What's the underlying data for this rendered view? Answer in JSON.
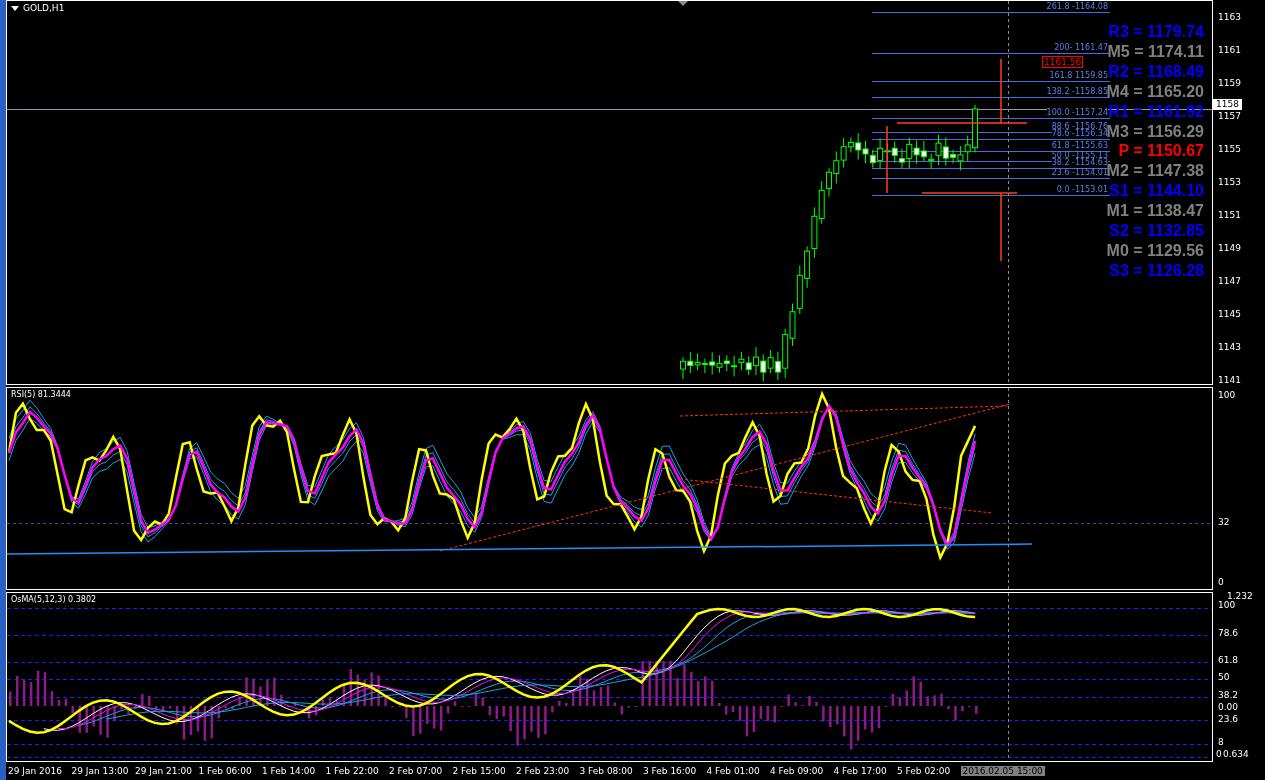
{
  "window": {
    "title": "GOLD,H1"
  },
  "price_pane": {
    "axis_labels": [
      "1163",
      "1161",
      "1159",
      "1157",
      "1155",
      "1153",
      "1151",
      "1149",
      "1147",
      "1145",
      "1143",
      "1141"
    ],
    "current_price": "1158",
    "price_tag": "1161.56",
    "fibonacci_levels": [
      {
        "label": "261.8 -1164.08"
      },
      {
        "label": "200- 1161.47"
      },
      {
        "label": "161.8 1159.85"
      },
      {
        "label": "138.2 -1158.85"
      },
      {
        "label": "100.0 -1157.24"
      },
      {
        "label": "88.6 -1156.76"
      },
      {
        "label": "78.6 -1156.34"
      },
      {
        "label": "61.8 -1155.63"
      },
      {
        "label": "50.0 -1155.13"
      },
      {
        "label": "38.2 -1154.63"
      },
      {
        "label": "23.6 -1154.01"
      },
      {
        "label": "0.0 -1153.01"
      }
    ],
    "pivot_levels": [
      {
        "label": "R3 = 1179.74",
        "color": "#0000ff"
      },
      {
        "label": "M5 = 1174.11",
        "color": "#808080"
      },
      {
        "label": "R2 = 1168.49",
        "color": "#0000ff"
      },
      {
        "label": "M4 = 1165.20",
        "color": "#808080"
      },
      {
        "label": "R1 = 1161.92",
        "color": "#0000ff"
      },
      {
        "label": "M3 = 1156.29",
        "color": "#808080"
      },
      {
        "label": "P  = 1150.67",
        "color": "#ff0000"
      },
      {
        "label": "M2 = 1147.38",
        "color": "#808080"
      },
      {
        "label": "S1 = 1144.10",
        "color": "#0000ff"
      },
      {
        "label": "M1 = 1138.47",
        "color": "#808080"
      },
      {
        "label": "S2 = 1132.85",
        "color": "#0000ff"
      },
      {
        "label": "M0 = 1129.56",
        "color": "#808080"
      },
      {
        "label": "S3 = 1126.28",
        "color": "#0000ff"
      }
    ]
  },
  "rsi_pane": {
    "label": "RSI(5) 81.3444",
    "axis_labels": [
      "100",
      "32",
      "0"
    ]
  },
  "osma_pane": {
    "label": "OsMA(5,12,3) 0.3802",
    "axis_labels": [
      "1.232",
      "100",
      "78.6",
      "61.8",
      "50",
      "38.2",
      "0.00",
      "23.6",
      "8",
      "0",
      "0.634"
    ]
  },
  "time_axis": {
    "labels": [
      "29 Jan 2016",
      "29 Jan 13:00",
      "29 Jan 21:00",
      "1 Feb 06:00",
      "1 Feb 14:00",
      "1 Feb 22:00",
      "2 Feb 07:00",
      "2 Feb 15:00",
      "2 Feb 23:00",
      "3 Feb 08:00",
      "3 Feb 16:00",
      "4 Feb 01:00",
      "4 Feb 09:00",
      "4 Feb 17:00",
      "5 Feb 02:00"
    ],
    "crosshair_time": "2016.02.05 15:00"
  }
}
